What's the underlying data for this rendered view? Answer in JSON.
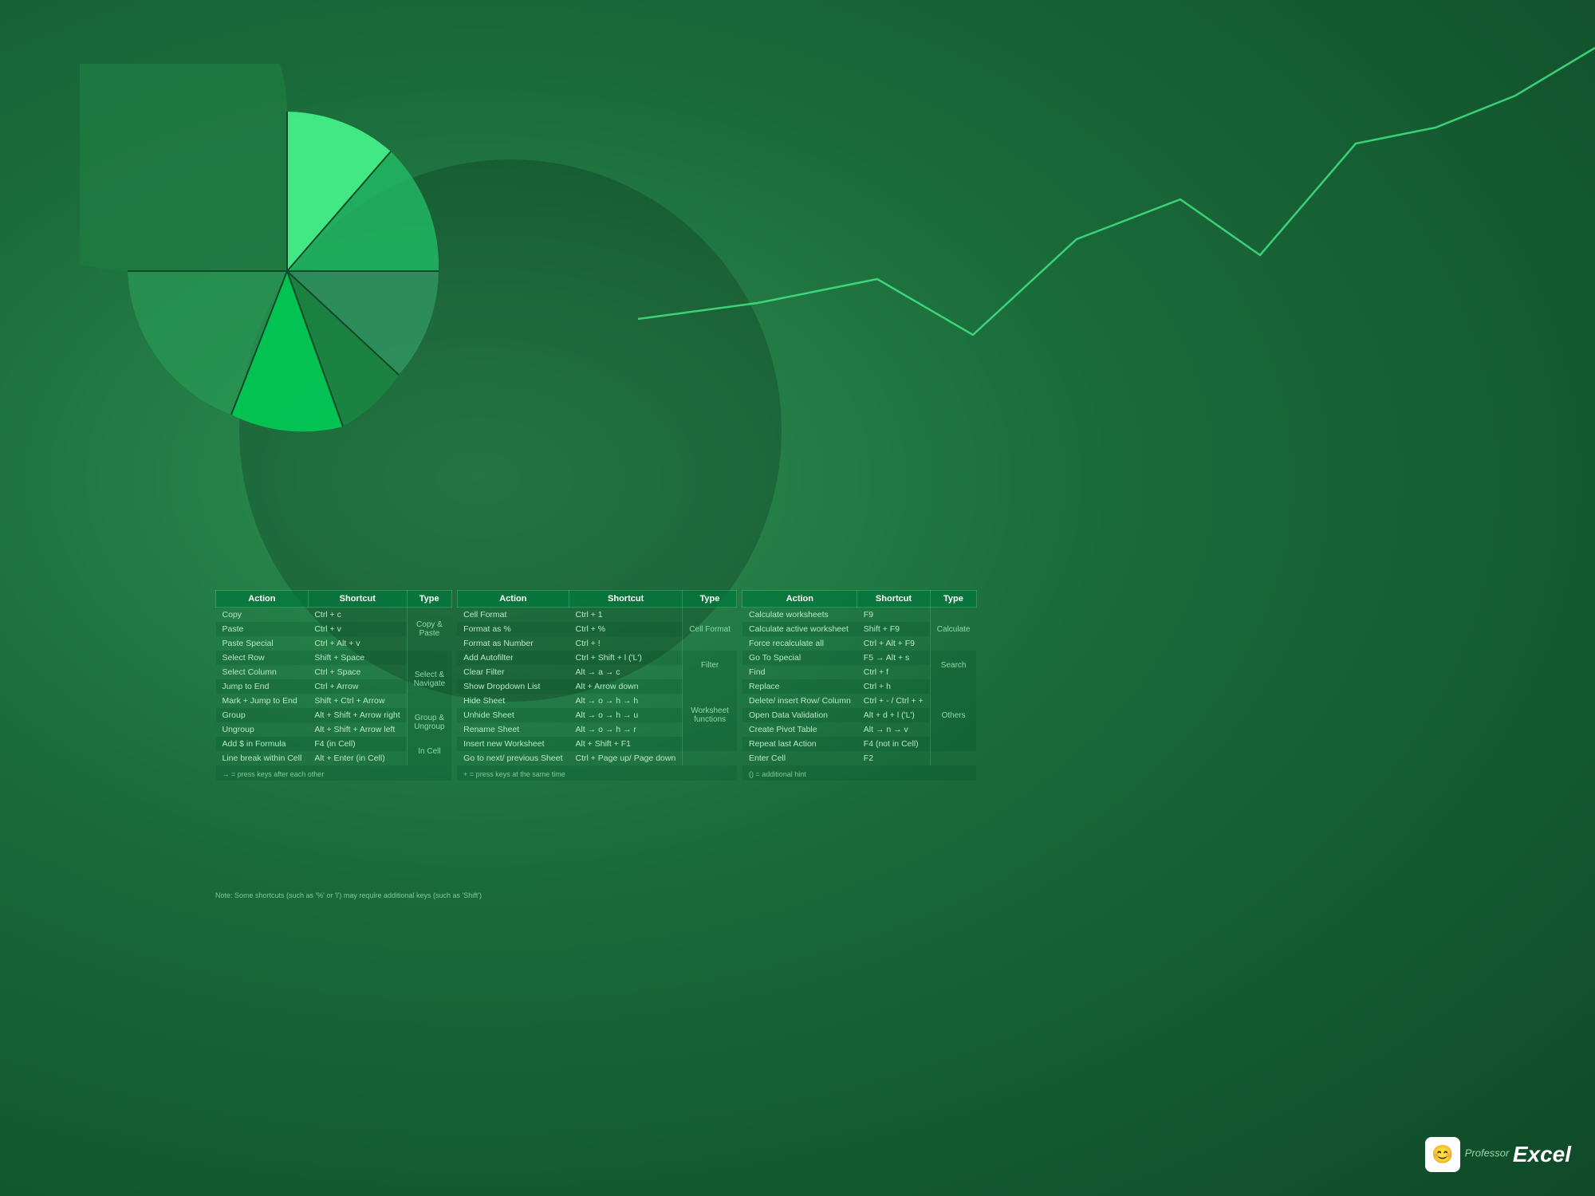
{
  "background": {
    "color": "#1a6b3a"
  },
  "table1": {
    "headers": [
      "Action",
      "Shortcut",
      "Type"
    ],
    "rows": [
      [
        "Copy",
        "Ctrl + c",
        ""
      ],
      [
        "Paste",
        "Ctrl + v",
        "Copy &"
      ],
      [
        "Paste Special",
        "Ctrl + Alt + v",
        "Paste"
      ],
      [
        "Select Row",
        "Shift + Space",
        ""
      ],
      [
        "Select Column",
        "Ctrl + Space",
        "Select &"
      ],
      [
        "Jump to End",
        "Ctrl + Arrow",
        "Navigate"
      ],
      [
        "Mark + Jump to End",
        "Shift + Ctrl + Arrow",
        ""
      ],
      [
        "Group",
        "Alt + Shift + Arrow right",
        "Group &"
      ],
      [
        "Ungroup",
        "Alt + Shift + Arrow left",
        "Ungroup"
      ],
      [
        "Add $ in Formula",
        "F4 (in Cell)",
        "In Cell"
      ],
      [
        "Line break within Cell",
        "Alt + Enter (in Cell)",
        ""
      ]
    ],
    "notes": [
      "→ = press keys after each other",
      "+ = press keys at the same time",
      "() = additional hint"
    ]
  },
  "table2": {
    "headers": [
      "Action",
      "Shortcut",
      "Type"
    ],
    "rows": [
      [
        "Cell Format",
        "Ctrl + 1",
        ""
      ],
      [
        "Format as %",
        "Ctrl + %",
        "Cell Format"
      ],
      [
        "Format as Number",
        "Ctrl + !",
        ""
      ],
      [
        "Add Autofilter",
        "Ctrl + Shift + l ('L')",
        ""
      ],
      [
        "Clear Filter",
        "Alt → a → c",
        "Filter"
      ],
      [
        "Show Dropdown List",
        "Alt + Arrow down",
        ""
      ],
      [
        "Hide Sheet",
        "Alt → o → h → h",
        ""
      ],
      [
        "Unhide Sheet",
        "Alt → o → h → u",
        "Worksheet"
      ],
      [
        "Rename Sheet",
        "Alt → o → h → r",
        "functions"
      ],
      [
        "Insert new Worksheet",
        "Alt + Shift + F1",
        ""
      ],
      [
        "Go to next/ previous Sheet",
        "Ctrl + Page up/ Page down",
        ""
      ]
    ]
  },
  "table3": {
    "headers": [
      "Action",
      "Shortcut",
      "Type"
    ],
    "rows": [
      [
        "Calculate worksheets",
        "F9",
        ""
      ],
      [
        "Calculate active worksheet",
        "Shift + F9",
        "Calculate"
      ],
      [
        "Force recalculate all",
        "Ctrl + Alt + F9",
        ""
      ],
      [
        "Go To Special",
        "F5 → Alt + s",
        ""
      ],
      [
        "Find",
        "Ctrl + f",
        "Search"
      ],
      [
        "Replace",
        "Ctrl + h",
        ""
      ],
      [
        "Delete/ insert Row/ Column",
        "Ctrl + - / Ctrl + +",
        ""
      ],
      [
        "Open Data Validation",
        "Alt + d + l ('L')",
        ""
      ],
      [
        "Create Pivot Table",
        "Alt → n → v",
        "Others"
      ],
      [
        "Repeat last Action",
        "F4 (not in Cell)",
        ""
      ],
      [
        "Enter Cell",
        "F2",
        ""
      ]
    ]
  },
  "footer_notes": "Note: Some shortcuts (such as '%' or 'l') may require additional keys (such as 'Shift')",
  "logo": {
    "prefix": "Professor",
    "name": "Excel"
  }
}
